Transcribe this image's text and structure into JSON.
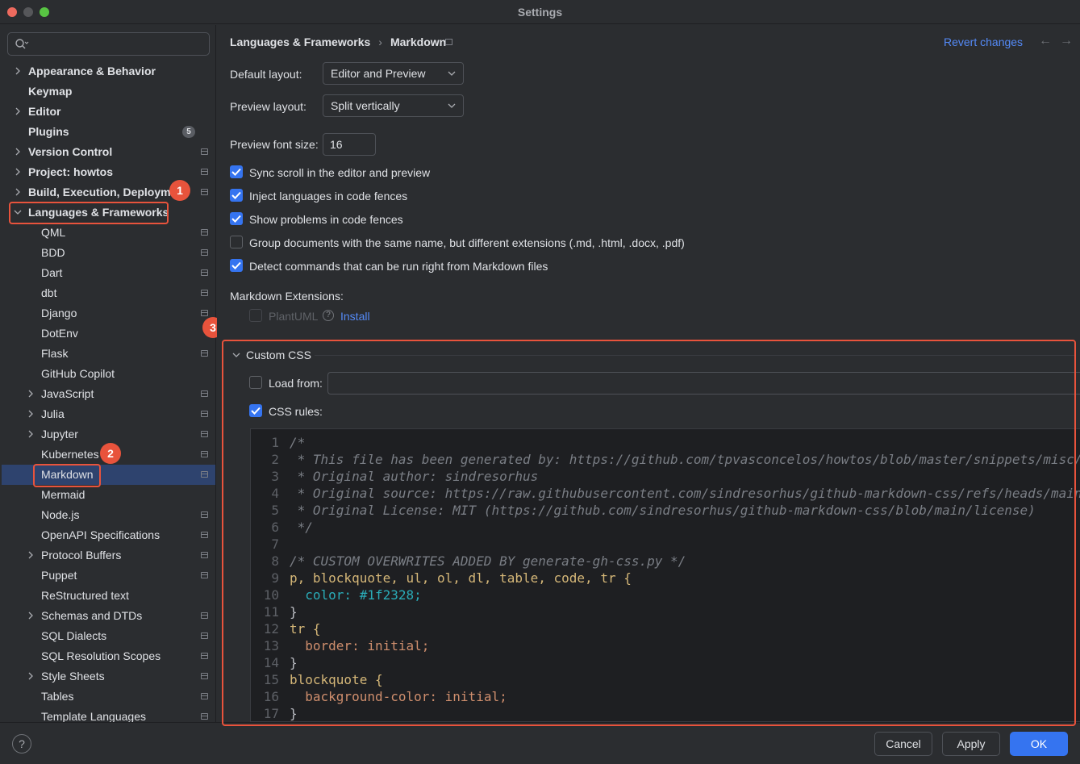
{
  "window": {
    "title": "Settings"
  },
  "search": {
    "placeholder": ""
  },
  "sidebar": {
    "items": [
      {
        "label": "Appearance & Behavior",
        "bold": true,
        "expandable": true
      },
      {
        "label": "Keymap",
        "bold": true
      },
      {
        "label": "Editor",
        "bold": true,
        "expandable": true
      },
      {
        "label": "Plugins",
        "bold": true,
        "badge": "5"
      },
      {
        "label": "Version Control",
        "bold": true,
        "expandable": true
      },
      {
        "label": "Project: howtos",
        "bold": true,
        "expandable": true
      },
      {
        "label": "Build, Execution, Deployment",
        "bold": true,
        "expandable": true
      },
      {
        "label": "Languages & Frameworks",
        "bold": true,
        "expanded": true
      },
      {
        "label": "QML"
      },
      {
        "label": "BDD"
      },
      {
        "label": "Dart"
      },
      {
        "label": "dbt"
      },
      {
        "label": "Django"
      },
      {
        "label": "DotEnv"
      },
      {
        "label": "Flask"
      },
      {
        "label": "GitHub Copilot"
      },
      {
        "label": "JavaScript",
        "expandable": true
      },
      {
        "label": "Julia",
        "expandable": true
      },
      {
        "label": "Jupyter",
        "expandable": true
      },
      {
        "label": "Kubernetes"
      },
      {
        "label": "Markdown",
        "selected": true
      },
      {
        "label": "Mermaid"
      },
      {
        "label": "Node.js"
      },
      {
        "label": "OpenAPI Specifications"
      },
      {
        "label": "Protocol Buffers",
        "expandable": true
      },
      {
        "label": "Puppet"
      },
      {
        "label": "ReStructured text"
      },
      {
        "label": "Schemas and DTDs",
        "expandable": true
      },
      {
        "label": "SQL Dialects"
      },
      {
        "label": "SQL Resolution Scopes"
      },
      {
        "label": "Style Sheets",
        "expandable": true
      },
      {
        "label": "Tables"
      },
      {
        "label": "Template Languages"
      }
    ]
  },
  "annotations": {
    "m1": "1",
    "m2": "2",
    "m3": "3"
  },
  "header": {
    "breadcrumb_parent": "Languages & Frameworks",
    "breadcrumb_sep": "›",
    "breadcrumb_current": "Markdown",
    "revert": "Revert changes",
    "back_arrow": "←",
    "forward_arrow": "→"
  },
  "form": {
    "default_layout_label": "Default layout:",
    "default_layout_value": "Editor and Preview",
    "preview_layout_label": "Preview layout:",
    "preview_layout_value": "Split vertically",
    "font_size_label": "Preview font size:",
    "font_size_value": "16",
    "checkboxes": [
      {
        "label": "Sync scroll in the editor and preview",
        "checked": true
      },
      {
        "label": "Inject languages in code fences",
        "checked": true
      },
      {
        "label": "Show problems in code fences",
        "checked": true
      },
      {
        "label": "Group documents with the same name, but different extensions (.md, .html, .docx, .pdf)",
        "checked": false
      },
      {
        "label": "Detect commands that can be run right from Markdown files",
        "checked": true
      }
    ],
    "extensions_label": "Markdown Extensions:",
    "plantuml_label": "PlantUML",
    "help_glyph": "?",
    "install_link": "Install"
  },
  "custom_css": {
    "title": "Custom CSS",
    "load_from_label": "Load from:",
    "load_from_checked": false,
    "load_from_value": "",
    "css_rules_label": "CSS rules:",
    "css_rules_checked": true,
    "code_lines": [
      {
        "n": "1",
        "t": "/*"
      },
      {
        "n": "2",
        "t": " * This file has been generated by: https://github.com/tpvasconcelos/howtos/blob/master/snippets/misc/"
      },
      {
        "n": "3",
        "t": " * Original author: sindresorhus"
      },
      {
        "n": "4",
        "t": " * Original source: https://raw.githubusercontent.com/sindresorhus/github-markdown-css/refs/heads/main/"
      },
      {
        "n": "5",
        "t": " * Original License: MIT (https://github.com/sindresorhus/github-markdown-css/blob/main/license)"
      },
      {
        "n": "6",
        "t": " */"
      },
      {
        "n": "7",
        "t": ""
      },
      {
        "n": "8",
        "t": "/* CUSTOM OVERWRITES ADDED BY generate-gh-css.py */"
      },
      {
        "n": "9",
        "t": "p, blockquote, ul, ol, dl, table, code, tr {"
      },
      {
        "n": "10",
        "t": "  color: #1f2328;"
      },
      {
        "n": "11",
        "t": "}"
      },
      {
        "n": "12",
        "t": "tr {"
      },
      {
        "n": "13",
        "t": "  border: initial;"
      },
      {
        "n": "14",
        "t": "}"
      },
      {
        "n": "15",
        "t": "blockquote {"
      },
      {
        "n": "16",
        "t": "  background-color: initial;"
      },
      {
        "n": "17",
        "t": "}"
      }
    ]
  },
  "footer": {
    "help": "?",
    "cancel": "Cancel",
    "apply": "Apply",
    "ok": "OK"
  },
  "colors": {
    "background": "#2b2d30",
    "accent": "#3574f0",
    "highlight": "#e8533c",
    "link": "#548af7",
    "selection": "#2e436e"
  }
}
